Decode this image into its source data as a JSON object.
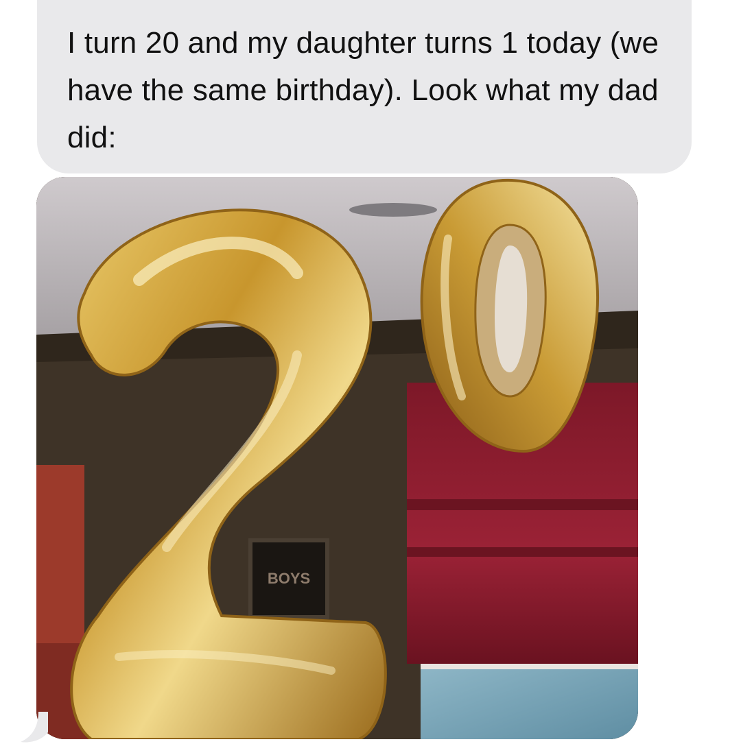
{
  "message": {
    "text": "I turn 20 and my daughter turns 1 today (we have the same birthday). Look what my dad did:",
    "sender": "incoming"
  },
  "photo": {
    "balloon_left_digit": "2",
    "balloon_right_digit": "0",
    "frame_text": "BOYS",
    "colors": {
      "bubble": "#e9e9eb",
      "gold": "#d2a63e",
      "ceiling": "#b9b4b8",
      "wall_dark": "#3e3327",
      "curtain_red": "#8f1f31"
    }
  }
}
